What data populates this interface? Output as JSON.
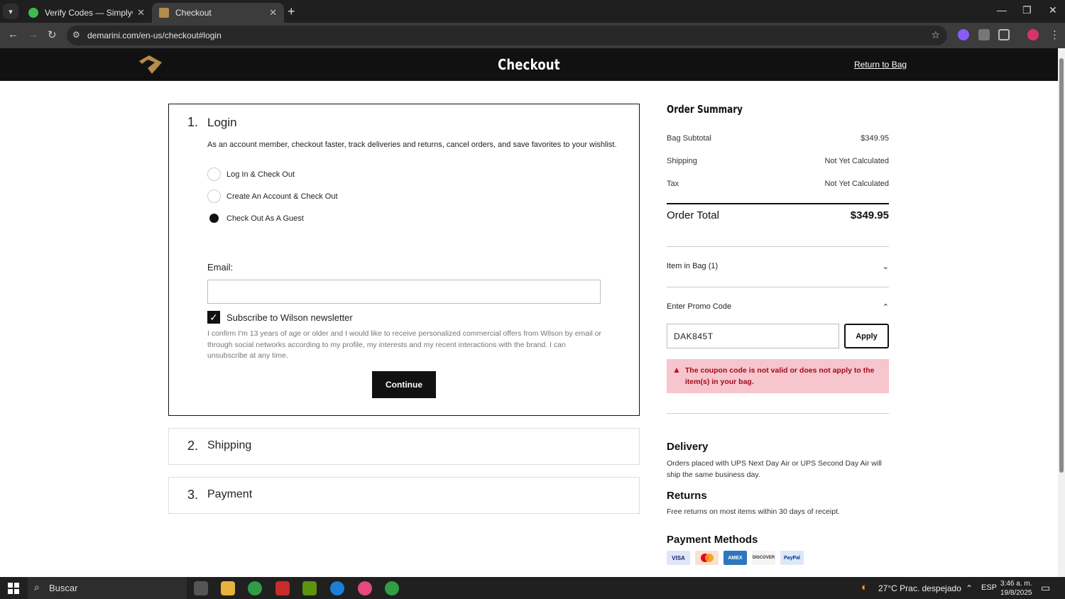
{
  "browser": {
    "tabs": [
      {
        "title": "Verify Codes — SimplyCodes",
        "active": false
      },
      {
        "title": "Checkout",
        "active": true
      }
    ],
    "url": "demarini.com/en-us/checkout#login"
  },
  "header": {
    "title": "Checkout",
    "return_link": "Return to Bag"
  },
  "login": {
    "step_number": "1.",
    "title": "Login",
    "description": "As an account member, checkout faster, track deliveries and returns, cancel orders, and save favorites to your wishlist.",
    "options": [
      {
        "label": "Log In & Check Out",
        "selected": false
      },
      {
        "label": "Create An Account & Check Out",
        "selected": false
      },
      {
        "label": "Check Out As A Guest",
        "selected": true
      }
    ],
    "email_label": "Email:",
    "email_value": "",
    "newsletter_label": "Subscribe to Wilson newsletter",
    "newsletter_checked": true,
    "consent_text": "I confirm I'm 13 years of age or older and I would like to receive personalized commercial offers from Wilson by email or through social networks according to my profile, my interests and my recent interactions with the brand. I can unsubscribe at any time.",
    "continue_label": "Continue"
  },
  "steps": [
    {
      "number": "2.",
      "title": "Shipping"
    },
    {
      "number": "3.",
      "title": "Payment"
    }
  ],
  "summary": {
    "title": "Order Summary",
    "rows": [
      {
        "label": "Bag Subtotal",
        "value": "$349.95"
      },
      {
        "label": "Shipping",
        "value": "Not Yet Calculated"
      },
      {
        "label": "Tax",
        "value": "Not Yet Calculated"
      }
    ],
    "total_label": "Order Total",
    "total_value": "$349.95",
    "items_label": "Item in Bag (1)",
    "promo_label": "Enter Promo Code",
    "promo_value": "DAK845T",
    "apply_label": "Apply",
    "error_text": "The coupon code is not valid or does not apply to the item(s) in your bag.",
    "delivery_title": "Delivery",
    "delivery_text": "Orders placed with UPS Next Day Air or UPS Second Day Air will ship the same business day.",
    "returns_title": "Returns",
    "returns_text": "Free returns on most items within 30 days of receipt.",
    "payment_title": "Payment Methods",
    "payment_methods": [
      "VISA",
      "mastercard",
      "AMEX",
      "DISCOVER",
      "PayPal"
    ]
  },
  "taskbar": {
    "search_placeholder": "Buscar",
    "weather": "27°C  Prac. despejado",
    "language": "ESP",
    "time": "3:46 a. m.",
    "date": "19/8/2025"
  },
  "colors": {
    "header_bg": "#111111",
    "error_bg": "#f6c5cd",
    "error_text": "#a30c19",
    "logo_gold": "#b38b4d"
  }
}
